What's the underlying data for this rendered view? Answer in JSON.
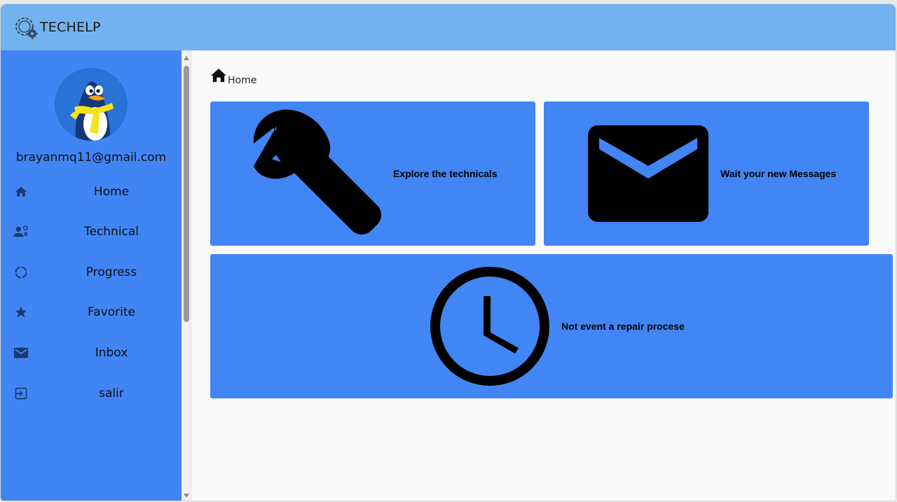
{
  "app": {
    "title": "TECHELP"
  },
  "user": {
    "email": "brayanmq11@gmail.com"
  },
  "sidebar": {
    "items": [
      {
        "label": "Home",
        "icon": "home-icon"
      },
      {
        "label": "Technical",
        "icon": "technical-users-icon"
      },
      {
        "label": "Progress",
        "icon": "progress-icon"
      },
      {
        "label": "Favorite",
        "icon": "star-icon"
      },
      {
        "label": "Inbox",
        "icon": "mail-icon"
      },
      {
        "label": "salir",
        "icon": "logout-icon"
      }
    ]
  },
  "breadcrumb": {
    "label": "Home"
  },
  "cards": [
    {
      "text": "Explore the technicals",
      "icon": "wrench-icon"
    },
    {
      "text": "Wait your new Messages",
      "icon": "envelope-icon"
    },
    {
      "text": "Not event a repair procese",
      "icon": "clock-icon"
    }
  ],
  "colors": {
    "topbar": "#72b2ef",
    "sidebar": "#4185f5",
    "card": "#4286f5",
    "content_bg": "#fafafa"
  }
}
